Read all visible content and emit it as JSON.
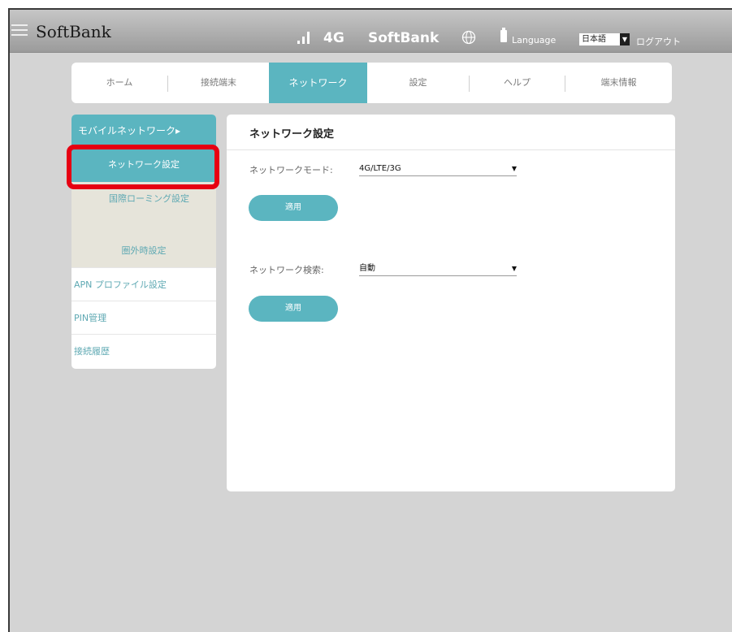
{
  "header": {
    "brand": "SoftBank",
    "network_type": "4G",
    "carrier": "SoftBank",
    "language_label": "Language",
    "language_value": "日本語",
    "logout": "ログアウト",
    "icons": [
      "menu-icon",
      "signal-icon",
      "globe-icon",
      "battery-icon"
    ]
  },
  "tabs": [
    {
      "label": "ホーム"
    },
    {
      "label": "接続端末"
    },
    {
      "label": "ネットワーク",
      "active": true
    },
    {
      "label": "設定"
    },
    {
      "label": "ヘルプ"
    },
    {
      "label": "端末情報"
    }
  ],
  "sidebar": {
    "heading": "モバイルネットワーク",
    "subitems": [
      {
        "label": "ネットワーク設定",
        "active": true
      },
      {
        "label": "国際ローミング設定"
      },
      {
        "label": "圏外時設定"
      }
    ],
    "items": [
      {
        "label": "APN プロファイル設定"
      },
      {
        "label": "PIN管理"
      },
      {
        "label": "接続履歴"
      }
    ]
  },
  "content": {
    "title": "ネットワーク設定",
    "network_mode": {
      "label": "ネットワークモード:",
      "value": "4G/LTE/3G"
    },
    "network_search": {
      "label": "ネットワーク検索:",
      "value": "自動"
    },
    "apply_label": "適用"
  },
  "colors": {
    "accent": "#5bb5c0",
    "highlight": "#e60012",
    "background": "#d4d4d4"
  }
}
